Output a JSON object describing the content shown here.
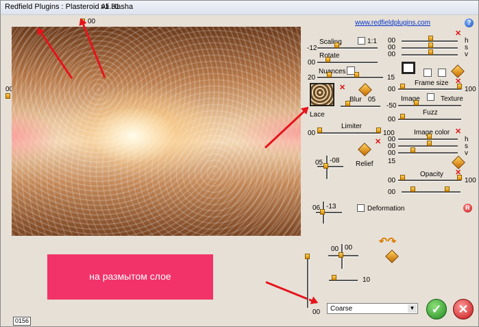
{
  "window": {
    "title": "Redfield Plugins : Plasteroid v1.31",
    "author": "Ali Hasha"
  },
  "link": "www.redfieldplugins.com",
  "preview": {
    "top_value": "00",
    "left_value": "00",
    "counter": "0156"
  },
  "banner": {
    "text": "на размытом слое"
  },
  "scaling": {
    "label": "Scaling",
    "one_to_one": "1:1",
    "value": "-12"
  },
  "rotate": {
    "label": "Rotate",
    "value": "00"
  },
  "nuances": {
    "label": "Nuances",
    "value_left": "20",
    "value_right": "15"
  },
  "lace": {
    "label": "Lace"
  },
  "blur": {
    "label": "Blur",
    "value": "05"
  },
  "limiter": {
    "label": "Limiter",
    "value_left": "00",
    "value_right": "100"
  },
  "relief": {
    "label": "Relief",
    "x": "05",
    "y": "-08"
  },
  "deformation": {
    "label": "Deformation",
    "x": "06",
    "y": "-13"
  },
  "bottom_pad": {
    "x": "00",
    "y": "00",
    "value": "10",
    "vertical_value": "00"
  },
  "hsv_top": {
    "h": "00",
    "s": "00",
    "v": "00",
    "h_label": "h",
    "s_label": "s",
    "v_label": "v"
  },
  "frame_size": {
    "label": "Frame size",
    "value_left": "00",
    "value_right": "100"
  },
  "image_texture": {
    "image_label": "Image",
    "texture_label": "Texture",
    "value": "-50"
  },
  "fuzz": {
    "label": "Fuzz",
    "value": "00"
  },
  "image_color": {
    "label": "Image color",
    "h": "00",
    "s": "00",
    "v": "00",
    "h_label": "h",
    "s_label": "s",
    "v_label": "v",
    "extra": "15"
  },
  "opacity": {
    "label": "Opacity",
    "value_left": "00",
    "value_right": "100",
    "row2": "00"
  },
  "combo": {
    "value": "Coarse"
  },
  "buttons": {
    "help": "?",
    "reset": "R",
    "ok": "✓",
    "cancel": "✕"
  },
  "colors": {
    "banner": "#f2336a",
    "arrow": "#e5141c",
    "window_bg": "#e7e0d6"
  }
}
